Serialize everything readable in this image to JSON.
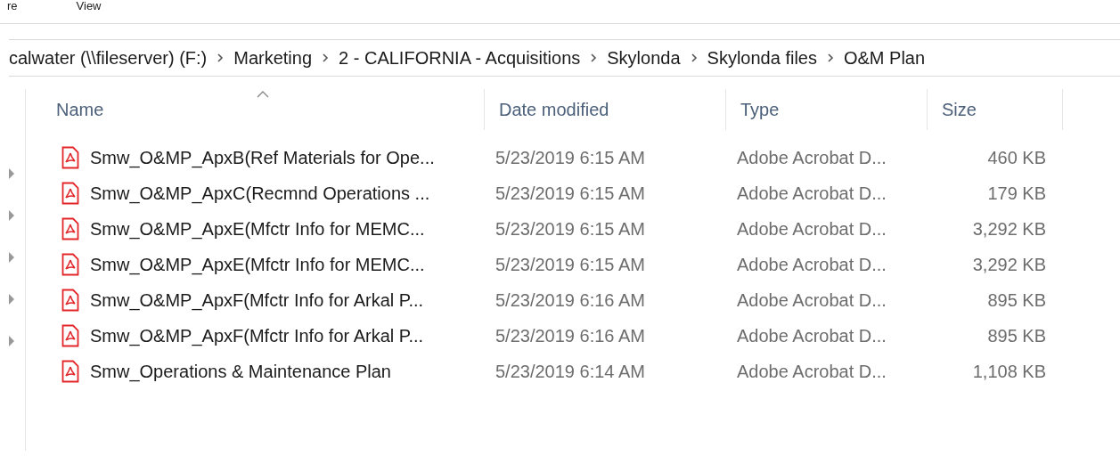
{
  "ribbon": {
    "tabs": [
      {
        "label": "re",
        "selected": false
      },
      {
        "label": "View",
        "selected": false
      }
    ]
  },
  "address_bar": {
    "path": [
      "calwater (\\\\fileserver) (F:)",
      "Marketing",
      "2 - CALIFORNIA - Acquisitions",
      "Skylonda",
      "Skylonda files",
      "O&M Plan"
    ]
  },
  "nav_pane": {
    "nodes": [
      {
        "expanded": false
      },
      {
        "expanded": false
      },
      {
        "expanded": false
      },
      {
        "expanded": false
      },
      {
        "expanded": false
      }
    ]
  },
  "table": {
    "columns": [
      {
        "label": "Name",
        "sorted": true
      },
      {
        "label": "Date modified",
        "sorted": false
      },
      {
        "label": "Type",
        "sorted": false
      },
      {
        "label": "Size",
        "sorted": false
      }
    ],
    "rows": [
      {
        "kind": "pdf",
        "name": "Smw_O&MP_ApxB(Ref Materials for Ope...",
        "date_modified": "5/23/2019 6:15 AM",
        "type": "Adobe Acrobat D...",
        "size": "460 KB"
      },
      {
        "kind": "pdf",
        "name": "Smw_O&MP_ApxC(Recmnd Operations ...",
        "date_modified": "5/23/2019 6:15 AM",
        "type": "Adobe Acrobat D...",
        "size": "179 KB"
      },
      {
        "kind": "pdf",
        "name": "Smw_O&MP_ApxE(Mfctr Info for MEMC...",
        "date_modified": "5/23/2019 6:15 AM",
        "type": "Adobe Acrobat D...",
        "size": "3,292 KB"
      },
      {
        "kind": "pdf",
        "name": "Smw_O&MP_ApxE(Mfctr Info for MEMC...",
        "date_modified": "5/23/2019 6:15 AM",
        "type": "Adobe Acrobat D...",
        "size": "3,292 KB"
      },
      {
        "kind": "pdf",
        "name": "Smw_O&MP_ApxF(Mfctr Info for Arkal P...",
        "date_modified": "5/23/2019 6:16 AM",
        "type": "Adobe Acrobat D...",
        "size": "895 KB"
      },
      {
        "kind": "pdf",
        "name": "Smw_O&MP_ApxF(Mfctr Info for Arkal P...",
        "date_modified": "5/23/2019 6:16 AM",
        "type": "Adobe Acrobat D...",
        "size": "895 KB"
      },
      {
        "kind": "pdf",
        "name": "Smw_Operations & Maintenance Plan",
        "date_modified": "5/23/2019 6:14 AM",
        "type": "Adobe Acrobat D...",
        "size": "1,108 KB"
      }
    ]
  }
}
